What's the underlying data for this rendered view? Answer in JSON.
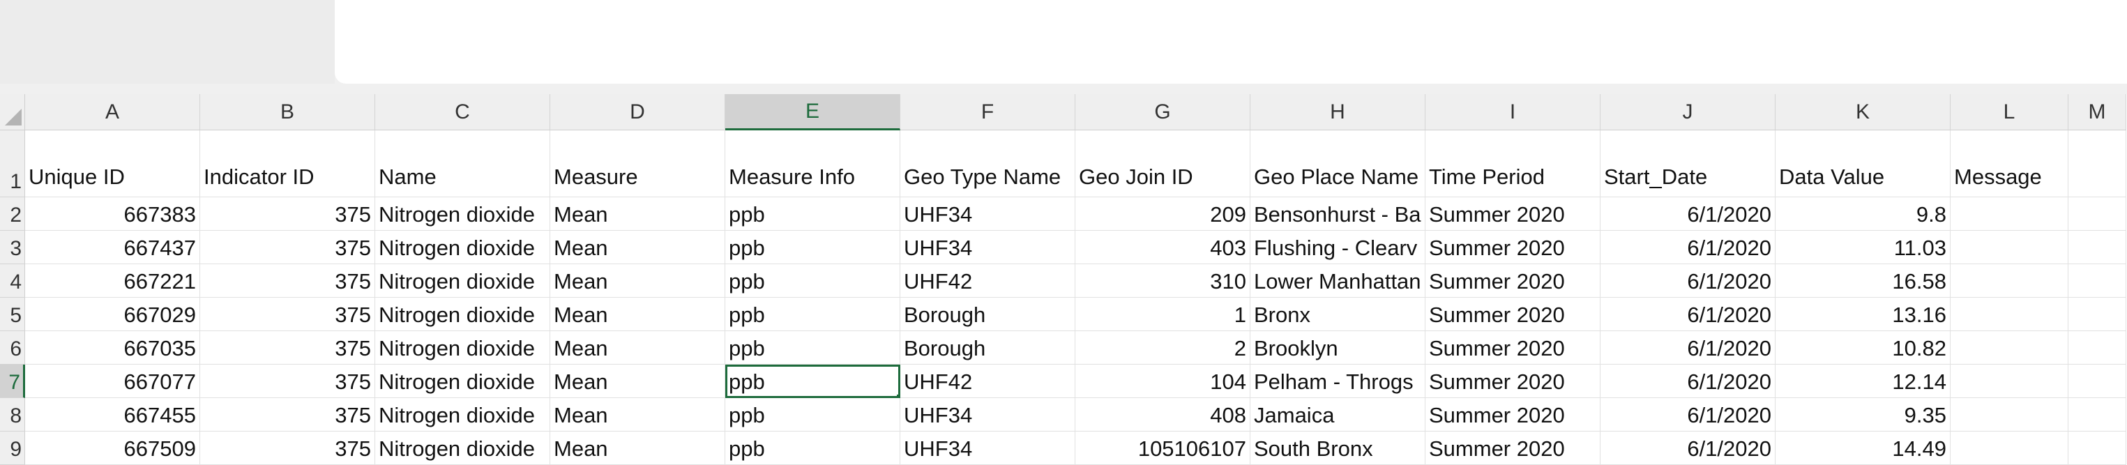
{
  "columns": [
    "A",
    "B",
    "C",
    "D",
    "E",
    "F",
    "G",
    "H",
    "I",
    "J",
    "K",
    "L",
    "M"
  ],
  "selected_column": "E",
  "row_numbers": [
    "1",
    "2",
    "3",
    "4",
    "5",
    "6",
    "7",
    "8",
    "9"
  ],
  "selected_row": "7",
  "header_row": [
    "Unique ID",
    "Indicator ID",
    "Name",
    "Measure",
    "Measure Info",
    "Geo Type Name",
    "Geo Join ID",
    "Geo Place Name",
    "Time Period",
    "Start_Date",
    "Data Value",
    "Message",
    ""
  ],
  "rows": [
    [
      "667383",
      "375",
      "Nitrogen dioxide",
      "Mean",
      "ppb",
      "UHF34",
      "209",
      "Bensonhurst - Ba",
      "Summer 2020",
      "6/1/2020",
      "9.8",
      "",
      ""
    ],
    [
      "667437",
      "375",
      "Nitrogen dioxide",
      "Mean",
      "ppb",
      "UHF34",
      "403",
      "Flushing - Clearv",
      "Summer 2020",
      "6/1/2020",
      "11.03",
      "",
      ""
    ],
    [
      "667221",
      "375",
      "Nitrogen dioxide",
      "Mean",
      "ppb",
      "UHF42",
      "310",
      "Lower Manhattan",
      "Summer 2020",
      "6/1/2020",
      "16.58",
      "",
      ""
    ],
    [
      "667029",
      "375",
      "Nitrogen dioxide",
      "Mean",
      "ppb",
      "Borough",
      "1",
      "Bronx",
      "Summer 2020",
      "6/1/2020",
      "13.16",
      "",
      ""
    ],
    [
      "667035",
      "375",
      "Nitrogen dioxide",
      "Mean",
      "ppb",
      "Borough",
      "2",
      "Brooklyn",
      "Summer 2020",
      "6/1/2020",
      "10.82",
      "",
      ""
    ],
    [
      "667077",
      "375",
      "Nitrogen dioxide",
      "Mean",
      "ppb",
      "UHF42",
      "104",
      "Pelham - Throgs",
      "Summer 2020",
      "6/1/2020",
      "12.14",
      "",
      ""
    ],
    [
      "667455",
      "375",
      "Nitrogen dioxide",
      "Mean",
      "ppb",
      "UHF34",
      "408",
      "Jamaica",
      "Summer 2020",
      "6/1/2020",
      "9.35",
      "",
      ""
    ],
    [
      "667509",
      "375",
      "Nitrogen dioxide",
      "Mean",
      "ppb",
      "UHF34",
      "105106107",
      "South Bronx",
      "Summer 2020",
      "6/1/2020",
      "14.49",
      "",
      ""
    ]
  ],
  "active_cell": "E7",
  "colors": {
    "accent": "#1d6b3c",
    "header_bg": "#efefef",
    "selected_header_bg": "#d2d2d2"
  }
}
